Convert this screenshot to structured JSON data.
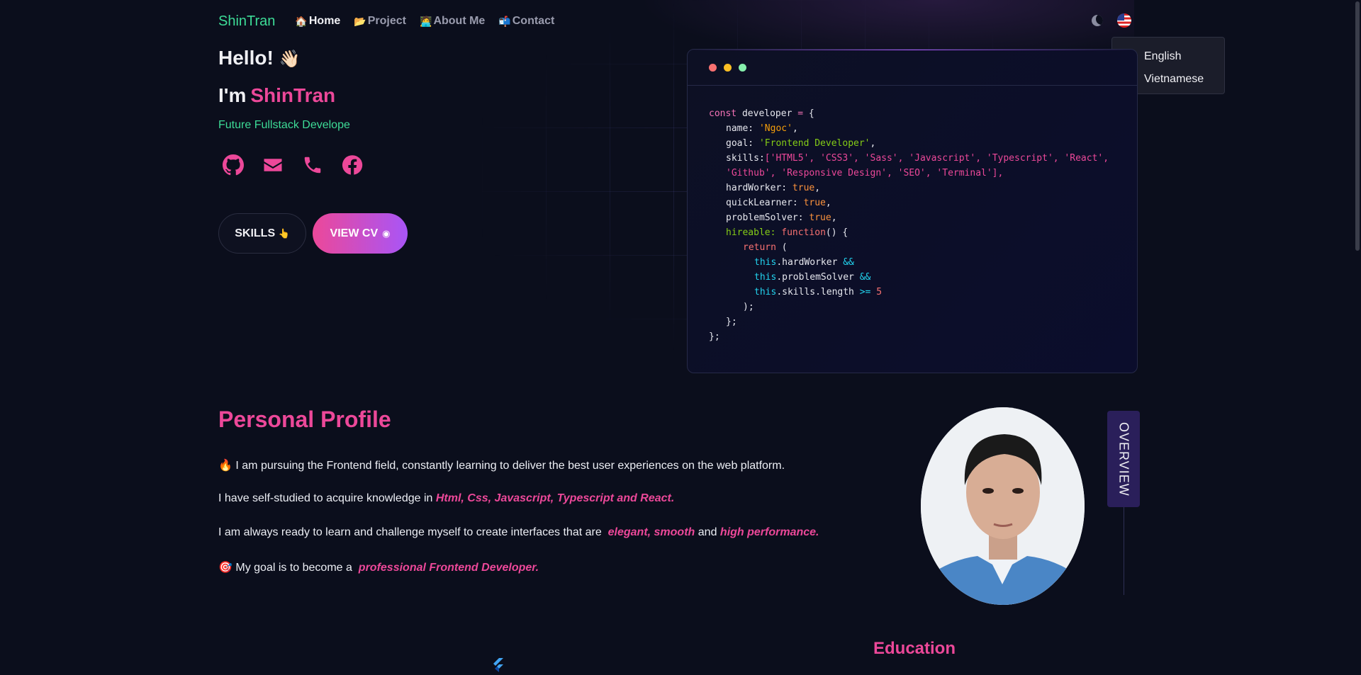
{
  "nav": {
    "logo": "ShinTran",
    "items": [
      {
        "icon": "🏠",
        "label": "Home"
      },
      {
        "icon": "📂",
        "label": "Project"
      },
      {
        "icon": "🧑‍💻",
        "label": "About Me"
      },
      {
        "icon": "📬",
        "label": "Contact"
      }
    ],
    "theme_icon": "moon-icon",
    "language_icon": "us-flag-icon"
  },
  "language_menu": {
    "options": [
      "English",
      "Vietnamese"
    ]
  },
  "hero": {
    "hello": "Hello!",
    "hello_emoji": "👋🏻",
    "im": "I'm",
    "name": "ShinTran",
    "subtitle": "Future Fullstack Develope",
    "socials": [
      "github-icon",
      "email-icon",
      "phone-icon",
      "facebook-icon"
    ],
    "skills_button": "SKILLS",
    "skills_emoji": "👆",
    "cv_button": "VIEW CV"
  },
  "code": {
    "lines": [
      "const developer = {",
      "name: 'Ngoc',",
      "goal: 'Frontend Developer',",
      "skills:['HTML5', 'CSS3', 'Sass', 'Javascript', 'Typescript', 'React',",
      "'Github', 'Responsive Design', 'SEO', 'Terminal'],",
      "hardWorker: true,",
      "quickLearner: true,",
      "problemSolver: true,",
      "hireable: function() {",
      "return (",
      "this.hardWorker &&",
      "this.problemSolver &&",
      "this.skills.length >= 5",
      ");",
      "};",
      "};"
    ],
    "dot_colors": [
      "#f87171",
      "#fbbf24",
      "#86efac"
    ]
  },
  "profile": {
    "title": "Personal Profile",
    "p1_emoji": "🔥",
    "p1": "I am pursuing the Frontend field, constantly learning to deliver the best user experiences on the web platform.",
    "p2_prefix": "I have self-studied to acquire knowledge in",
    "p2_highlight": "Html, Css, Javascript, Typescript and React.",
    "p3_prefix": "I am always ready to learn and challenge myself to create interfaces that are",
    "p3_highlight1": "elegant, smooth",
    "p3_and": "and",
    "p3_highlight2": "high performance.",
    "p4_emoji": "🎯",
    "p4_prefix": "My goal is to become a",
    "p4_highlight": "professional Frontend Developer.",
    "overview_tab": "OVERVIEW"
  },
  "education": {
    "title": "Education"
  },
  "colors": {
    "accent": "#ec4899",
    "green": "#3ddc97",
    "background": "#0b0e1c"
  }
}
